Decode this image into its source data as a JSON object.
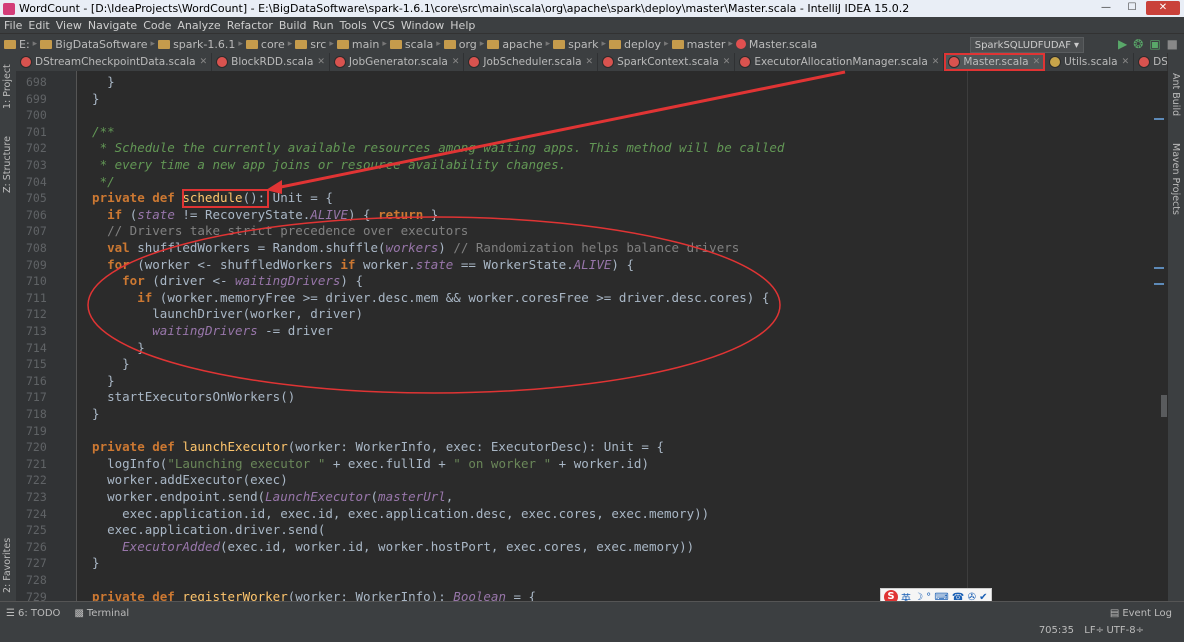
{
  "window": {
    "title": "WordCount - [D:\\IdeaProjects\\WordCount] - E:\\BigDataSoftware\\spark-1.6.1\\core\\src\\main\\scala\\org\\apache\\spark\\deploy\\master\\Master.scala - IntelliJ IDEA 15.0.2",
    "min": "—",
    "max": "☐",
    "close": "✕"
  },
  "menu": [
    "File",
    "Edit",
    "View",
    "Navigate",
    "Code",
    "Analyze",
    "Refactor",
    "Build",
    "Run",
    "Tools",
    "VCS",
    "Window",
    "Help"
  ],
  "breadcrumbs": [
    "E:",
    "BigDataSoftware",
    "spark-1.6.1",
    "core",
    "src",
    "main",
    "scala",
    "org",
    "apache",
    "spark",
    "deploy",
    "master",
    "Master.scala"
  ],
  "run_config": "SparkSQLUDFUDAF",
  "tabs": [
    {
      "label": "DStreamCheckpointData.scala",
      "active": false
    },
    {
      "label": "BlockRDD.scala",
      "active": false
    },
    {
      "label": "JobGenerator.scala",
      "active": false
    },
    {
      "label": "JobScheduler.scala",
      "active": false
    },
    {
      "label": "SparkContext.scala",
      "active": false
    },
    {
      "label": "ExecutorAllocationManager.scala",
      "active": false
    },
    {
      "label": "Master.scala",
      "active": true
    },
    {
      "label": "Utils.scala",
      "active": false
    },
    {
      "label": "DStreamGraph.scala",
      "active": false
    }
  ],
  "side_tools": {
    "project": "1: Project",
    "structure": "Z: Structure",
    "favorites": "2: Favorites",
    "ant_build": "Ant Build",
    "maven": "Maven Projects"
  },
  "line_numbers": [
    "698",
    "699",
    "700",
    "701",
    "702",
    "703",
    "704",
    "705",
    "706",
    "707",
    "708",
    "709",
    "710",
    "711",
    "712",
    "713",
    "714",
    "715",
    "716",
    "717",
    "718",
    "719",
    "720",
    "721",
    "722",
    "723",
    "724",
    "725",
    "726",
    "727",
    "728",
    "729"
  ],
  "code": {
    "l698": "    }",
    "l699": "  }",
    "l700": "",
    "l701": "  /**",
    "l702": "   * Schedule the currently available resources among waiting apps. This method will be called",
    "l703": "   * every time a new app joins or resource availability changes.",
    "l704": "   */",
    "l705_kw": "  private def ",
    "l705_fn": "schedule",
    "l705_rest": "(): Unit = {",
    "l706_a": "    ",
    "l706_if": "if",
    "l706_b": " (",
    "l706_state": "state",
    "l706_c": " != RecoveryState.",
    "l706_alive": "ALIVE",
    "l706_d": ") { ",
    "l706_ret": "return",
    "l706_e": " }",
    "l707": "    // Drivers take strict precedence over executors",
    "l708_val": "    val",
    "l708_a": " shuffledWorkers = Random.shuffle(",
    "l708_workers": "workers",
    "l708_b": ") ",
    "l708_cm": "// Randomization helps balance drivers",
    "l709_for": "    for",
    "l709_a": " (worker <- shuffledWorkers ",
    "l709_if": "if",
    "l709_b": " worker.",
    "l709_state": "state",
    "l709_c": " == WorkerState.",
    "l709_alive": "ALIVE",
    "l709_d": ") {",
    "l710_for": "      for",
    "l710_a": " (driver <- ",
    "l710_wd": "waitingDrivers",
    "l710_b": ") {",
    "l711_if": "        if",
    "l711_a": " (worker.memoryFree >= driver.desc.mem && worker.coresFree >= driver.desc.cores) {",
    "l712": "          launchDriver(worker, driver)",
    "l713_wd": "waitingDrivers",
    "l713_a": " -= driver",
    "l714": "        }",
    "l715": "      }",
    "l716": "    }",
    "l717": "    startExecutorsOnWorkers()",
    "l718": "  }",
    "l719": "",
    "l720_kw": "  private def ",
    "l720_fn": "launchExecutor",
    "l720_rest": "(worker: WorkerInfo, exec: ExecutorDesc): Unit = {",
    "l721_a": "    logInfo(",
    "l721_s1": "\"Launching executor \"",
    "l721_b": " + exec.fullId + ",
    "l721_s2": "\" on worker \"",
    "l721_c": " + worker.id)",
    "l722": "    worker.addExecutor(exec)",
    "l723_a": "    worker.endpoint.send(",
    "l723_le": "LaunchExecutor",
    "l723_b": "(",
    "l723_mu": "masterUrl",
    "l723_c": ",",
    "l724": "      exec.application.id, exec.id, exec.application.desc, exec.cores, exec.memory))",
    "l725": "    exec.application.driver.send(",
    "l726_ea": "ExecutorAdded",
    "l726_a": "(exec.id, worker.id, worker.hostPort, exec.cores, exec.memory))",
    "l727": "  }",
    "l728": "",
    "l729_kw": "  private def ",
    "l729_fn": "registerWorker",
    "l729_a": "(worker: WorkerInfo): ",
    "l729_ty": "Boolean",
    "l729_b": " = {"
  },
  "ime": {
    "logo": "S",
    "lang": "英",
    "icons": "☽ ° ⌨ ☎ ✇ ✔"
  },
  "status": {
    "todo": "6: TODO",
    "terminal": "Terminal",
    "event_log": "Event Log",
    "position": "705:35",
    "line_sep": "LF÷",
    "encoding": "UTF-8÷"
  },
  "colors": {
    "keyword": "#cc7832",
    "doc_comment": "#629755",
    "line_comment": "#808080",
    "string": "#6a8759",
    "function": "#ffc66d",
    "field": "#9876aa",
    "annotation_red": "#e03434"
  }
}
